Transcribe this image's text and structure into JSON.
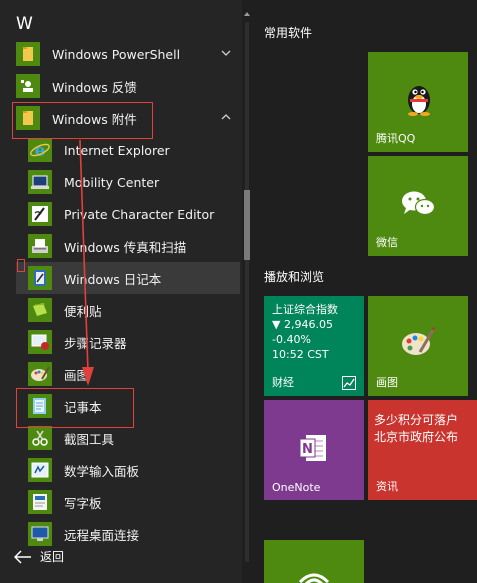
{
  "applist": {
    "letter": "W",
    "items": [
      {
        "label": "Windows PowerShell"
      },
      {
        "label": "Windows 反馈"
      },
      {
        "label": "Windows 附件"
      },
      {
        "label": "Internet Explorer"
      },
      {
        "label": "Mobility Center"
      },
      {
        "label": "Private Character Editor"
      },
      {
        "label": "Windows 传真和扫描"
      },
      {
        "label": "Windows 日记本"
      },
      {
        "label": "便利贴"
      },
      {
        "label": "步骤记录器"
      },
      {
        "label": "画图"
      },
      {
        "label": "记事本"
      },
      {
        "label": "截图工具"
      },
      {
        "label": "数学输入面板"
      },
      {
        "label": "写字板"
      },
      {
        "label": "远程桌面连接"
      }
    ],
    "back_label": "返回"
  },
  "tiles": {
    "group1_title": "常用软件",
    "qq_label": "腾讯QQ",
    "wechat_label": "微信",
    "group2_title": "播放和浏览",
    "finance": {
      "line1": "上证综合指数",
      "line2": "▼ 2,946.05",
      "line3": "-0.40%",
      "line4": "10:52 CST",
      "label": "财经"
    },
    "paint_label": "画图",
    "onenote_label": "OneNote",
    "news": {
      "headline1": "多少积分可落户",
      "headline2": "北京市政府公布",
      "label": "资讯"
    }
  },
  "colors": {
    "tile_green": "#4f8a10",
    "finance_green": "#00845a",
    "onenote_purple": "#7e3a8f",
    "news_red": "#c9342e",
    "annotation_red": "#e1413a"
  }
}
